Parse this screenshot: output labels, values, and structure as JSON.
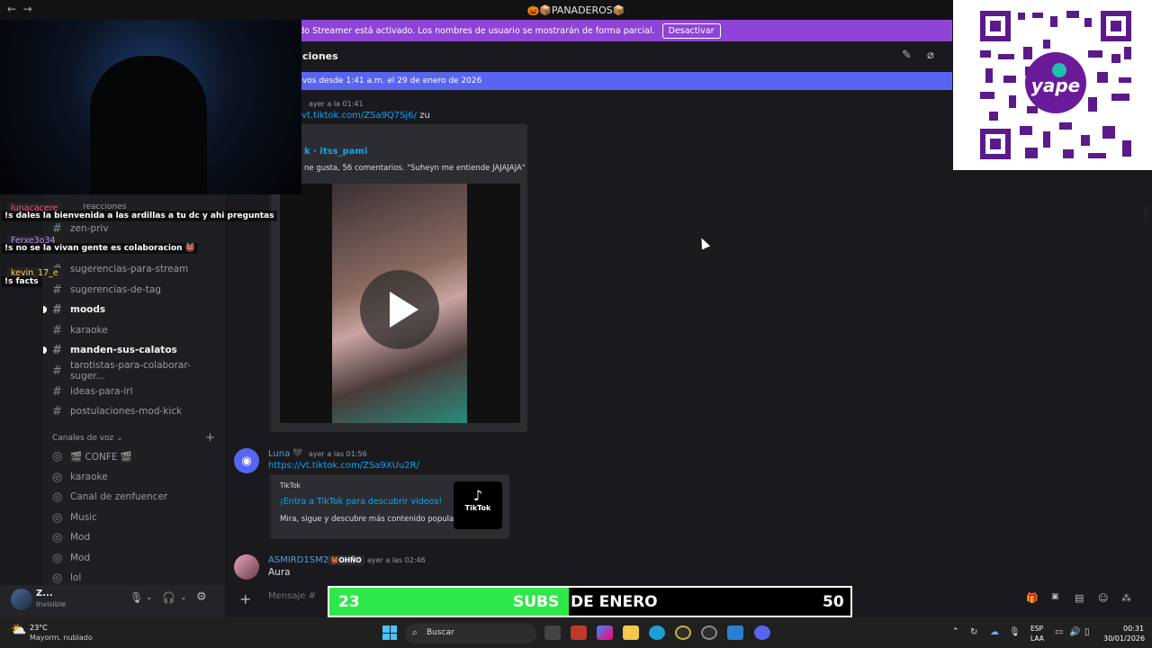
{
  "window": {
    "title": "🎃📦PANADEROS📦",
    "nav_icon": "back-forward-arrows"
  },
  "banner": {
    "text": "El modo Streamer está activado. Los nombres de usuario se mostrarán de forma parcial.",
    "button": "Desactivar"
  },
  "header": {
    "channel_partial": "ciones"
  },
  "new_messages_bar": {
    "text": "vos desde 1:41 a.m. el 29 de enero de 2026"
  },
  "sidebar": {
    "channels": [
      {
        "name": "zen-priv",
        "bold": false
      },
      {
        "name": "sugerencias-para-stream",
        "bold": false
      },
      {
        "name": "sugerencias-de-tag",
        "bold": false
      },
      {
        "name": "moods",
        "bold": true
      },
      {
        "name": "karaoke",
        "bold": false
      },
      {
        "name": "manden-sus-calatos",
        "bold": true
      },
      {
        "name": "tarotistas-para-colaborar-suger...",
        "bold": false
      },
      {
        "name": "ideas-para-irl",
        "bold": false
      },
      {
        "name": "postulaciones-mod-kick",
        "bold": false
      }
    ],
    "voice_header": "Canales de voz",
    "voice_channels": [
      {
        "name": "🎬 CONFE 🎬"
      },
      {
        "name": "karaoke"
      },
      {
        "name": "Canal de zenfuencer"
      },
      {
        "name": "Music"
      },
      {
        "name": "Mod"
      },
      {
        "name": "Mod"
      },
      {
        "name": "lol"
      }
    ],
    "reactions_label": "reacciones"
  },
  "messages": {
    "m1": {
      "time": "ayer a la 01:41",
      "link": "vt.tiktok.com/ZSa9Q7Sj6/",
      "suffix": "zu",
      "embed_author": "k · itss_pami",
      "embed_desc": "ne gusta, 56 comentarios. \"Suheyn me entiende JAJAJAJA\""
    },
    "m2": {
      "author": "Luna",
      "time": "ayer a las 01:56",
      "link": "https://vt.tiktok.com/ZSa9XUu2R/",
      "embed_provider": "TikTok",
      "embed_title": "¡Entra a TikTok para descubrir videos!",
      "embed_desc": "Mira, sigue y descubre más contenido popular.",
      "thumb_label": "TikTok"
    },
    "m3": {
      "author": "ASMIRD1SM2",
      "tag": "OHÑO",
      "time": "ayer a las 02:46",
      "text": "Aura"
    }
  },
  "chat_overlay": [
    {
      "user": "lunacacere",
      "color": "#ff4f8b",
      "message": "!s dales la bienvenida a las ardillas a tu dc y ahi preguntas"
    },
    {
      "user": "Ferxe3o34",
      "color": "#b98cff",
      "message": "!s no se la vivan gente es colaboracion 👹"
    },
    {
      "user": "kevin_17_e",
      "color": "#ffd34d",
      "message": "!s facts"
    }
  ],
  "qr": {
    "brand": "yape"
  },
  "user_panel": {
    "name": "Z...",
    "status": "Invisible"
  },
  "composer": {
    "placeholder": "Mensaje #"
  },
  "subs_bar": {
    "current": "23",
    "label_left": "SUBS",
    "label_right": "DE ENERO",
    "goal": "50",
    "progress": 0.46,
    "fill_color": "#2ee84a"
  },
  "taskbar": {
    "weather_temp": "23°C",
    "weather_desc": "Mayorm. nublado",
    "search": "Buscar",
    "lang1": "ESP",
    "lang2": "LAA",
    "time": "00:31",
    "date": "30/01/2026"
  }
}
